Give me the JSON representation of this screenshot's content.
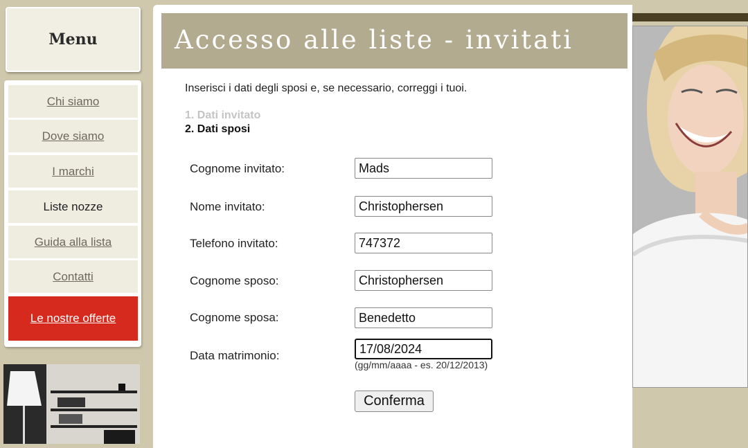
{
  "menu": {
    "title": "Menu",
    "items": [
      {
        "label": "Chi siamo"
      },
      {
        "label": "Dove siamo"
      },
      {
        "label": "I marchi"
      },
      {
        "label": "Liste nozze"
      },
      {
        "label": "Guida alla lista"
      },
      {
        "label": "Contatti"
      }
    ],
    "offer_label": "Le nostre offerte",
    "offer_color": "#d62a1e"
  },
  "header": {
    "title": "Accesso alle liste - invitati"
  },
  "intro": "Inserisci i dati degli sposi e, se necessario, correggi i tuoi.",
  "steps": [
    "1. Dati invitato",
    "2. Dati sposi"
  ],
  "form": {
    "cognome_invitato": {
      "label": "Cognome invitato:",
      "value": "Mads"
    },
    "nome_invitato": {
      "label": "Nome invitato:",
      "value": "Christophersen"
    },
    "telefono_invitato": {
      "label": "Telefono invitato:",
      "value": "747372"
    },
    "cognome_sposo": {
      "label": "Cognome sposo:",
      "value": "Christophersen"
    },
    "cognome_sposa": {
      "label": "Cognome sposa:",
      "value": "Benedetto"
    },
    "data_matrimonio": {
      "label": "Data matrimonio:",
      "value": "17/08/2024",
      "hint": "(gg/mm/aaaa - es. 20/12/2013)"
    },
    "submit_label": "Conferma"
  }
}
